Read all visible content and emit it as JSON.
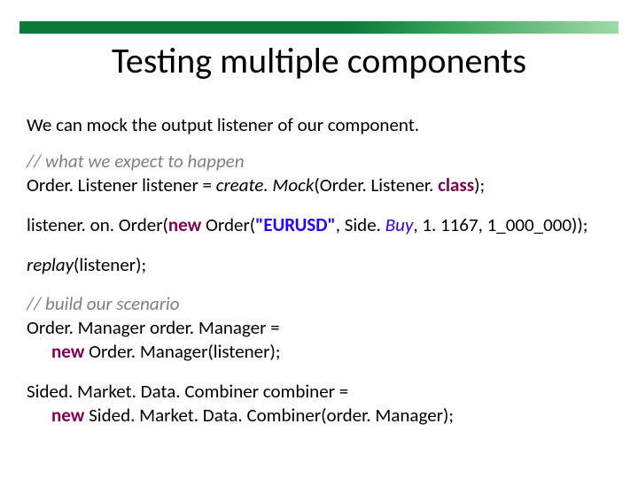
{
  "title": "Testing multiple components",
  "intro": "We can mock the output listener of our component.",
  "code": {
    "c1": "// what we expect to happen",
    "l1a": "Order. Listener listener = ",
    "l1b": "create. Mock",
    "l1c": "(Order. Listener. ",
    "l1d": "class",
    "l1e": ");",
    "l2a": "listener. on. Order(",
    "l2b": "new ",
    "l2c": "Order(",
    "l2d": "\"EURUSD\"",
    "l2e": ", Side. ",
    "l2f": "Buy",
    "l2g": ", 1. 1167, 1_000_000));",
    "l3a": "replay",
    "l3b": "(listener);",
    "c2": "// build our scenario",
    "l4a": "Order. Manager order. Manager =",
    "l4b": "new ",
    "l4c": "Order. Manager(listener);",
    "l5a": "Sided. Market. Data. Combiner combiner =",
    "l5b": "new ",
    "l5c": "Sided. Market. Data. Combiner(order. Manager);"
  }
}
